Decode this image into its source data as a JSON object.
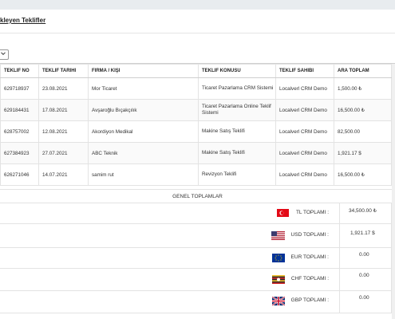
{
  "page": {
    "title": "kleyen Teklifler"
  },
  "table": {
    "headers": [
      "TEKLIF NO",
      "TEKLIF TARIHI",
      "FIRMA / KIŞI",
      "TEKLIF KONUSU",
      "TEKLIF SAHIBI",
      "ARA TOPLAM"
    ],
    "rows": [
      [
        "629718937",
        "23.08.2021",
        "Mor Ticaret",
        "Ticaret Pazarlama CRM Sistemi",
        "Localverl CRM Demo",
        "1,500.00 ₺"
      ],
      [
        "629184431",
        "17.08.2021",
        "Avşaroğlu Bıçakçılık",
        "Ticaret Pazarlama Online Teklif Sistemi",
        "Localverl CRM Demo",
        "16,500.00 ₺"
      ],
      [
        "628757002",
        "12.08.2021",
        "Akordiyon Medikal",
        "Makine Satış Teklifi",
        "Localverl CRM Demo",
        "82,500.00"
      ],
      [
        "627384923",
        "27.07.2021",
        "ABC Teknik",
        "Makine Satış Teklifi",
        "Localverl CRM Demo",
        "1,921.17 $"
      ],
      [
        "626271046",
        "14.07.2021",
        "samim rut",
        "Revizyon Teklifi",
        "Localverl CRM Demo",
        "16,500.00 ₺"
      ]
    ]
  },
  "totals": {
    "heading": "GENEL TOPLAMLAR",
    "items": [
      {
        "flag": "turkey-flag-icon",
        "label": "TL TOPLAMI :",
        "value": "34,500.00 ₺"
      },
      {
        "flag": "usa-flag-icon",
        "label": "USD TOPLAMI :",
        "value": "1,921.17 $"
      },
      {
        "flag": "eu-flag-icon",
        "label": "EUR TOPLAMI :",
        "value": "0.00"
      },
      {
        "flag": "switzerland-flag-icon",
        "label": "CHF TOPLAMI :",
        "value": "0.00"
      },
      {
        "flag": "uk-flag-icon",
        "label": "GBP TOPLAMI :",
        "value": "0.00"
      }
    ]
  }
}
